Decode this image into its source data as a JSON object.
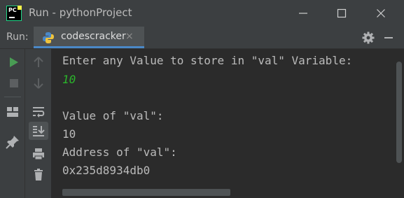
{
  "window": {
    "title": "Run - pythonProject",
    "logo_text": "PC"
  },
  "run_panel": {
    "label": "Run:",
    "tab_label": "codescracker",
    "tab_close": "×"
  },
  "console": {
    "lines": [
      "Enter any Value to store in \"val\" Variable: ",
      "10",
      "",
      "Value of \"val\":",
      "10",
      "Address of \"val\":",
      "0x235d8934db0"
    ]
  },
  "colors": {
    "background": "#2b2b2b",
    "toolbar": "#3c3f41",
    "run_green": "#499c54",
    "user_input": "#2bb52b",
    "tab_underline": "#4a88c7"
  }
}
